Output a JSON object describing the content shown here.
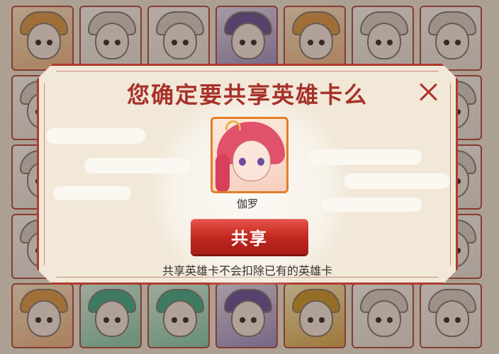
{
  "dialog": {
    "title": "您确定要共享英雄卡么",
    "close_icon": "close-icon",
    "hero": {
      "name": "伽罗",
      "portrait_icon": "hero-portrait"
    },
    "share_button_label": "共享",
    "note": "共享英雄卡不会扣除已有的英雄卡"
  },
  "colors": {
    "accent": "#a8312a",
    "button": "#c0271f",
    "dialog_bg": "#f1e8d8",
    "card_border": "#c24a3e"
  }
}
